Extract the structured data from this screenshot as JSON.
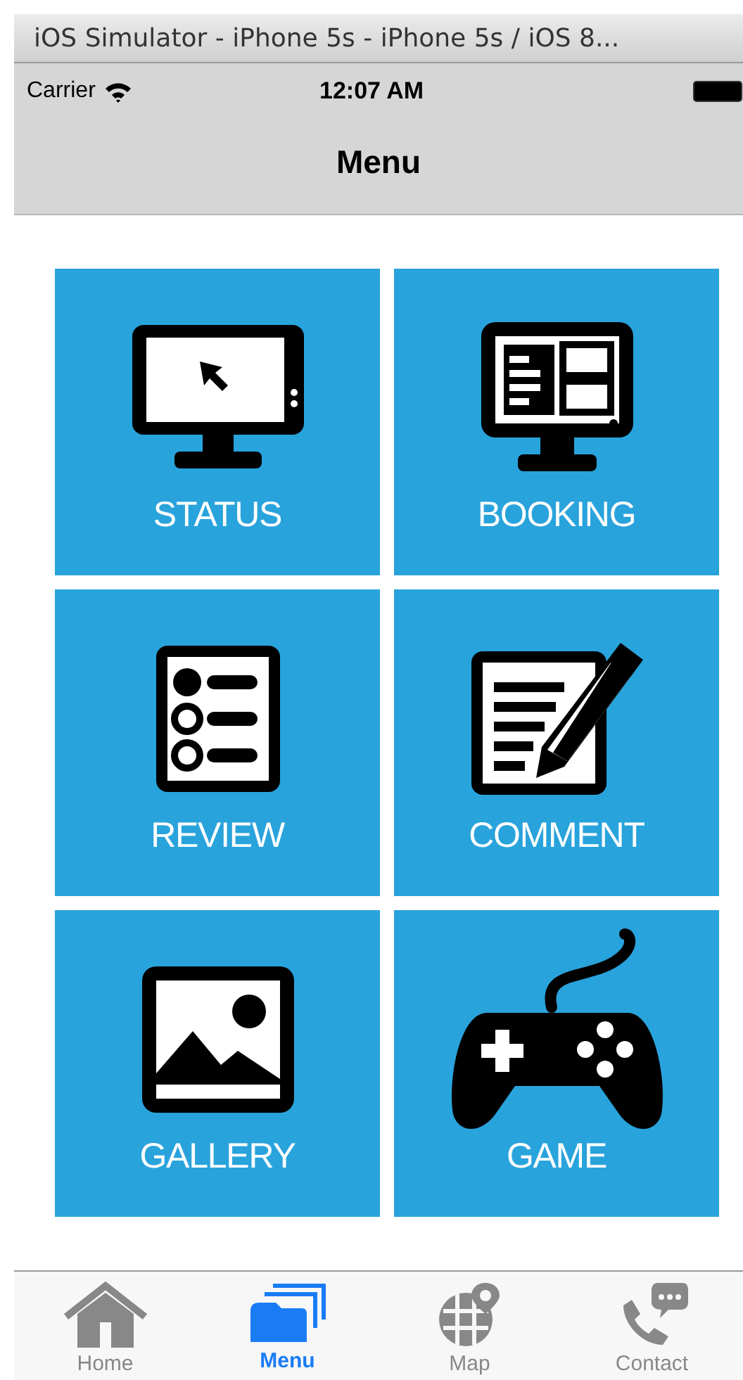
{
  "window": {
    "title": "iOS Simulator - iPhone 5s - iPhone 5s / iOS 8..."
  },
  "status_bar": {
    "carrier": "Carrier",
    "time": "12:07 AM"
  },
  "nav_bar": {
    "title": "Menu"
  },
  "tiles": [
    {
      "label": "STATUS",
      "kind": "monitor"
    },
    {
      "label": "BOOKING",
      "kind": "layout"
    },
    {
      "label": "REVIEW",
      "kind": "checklist"
    },
    {
      "label": "COMMENT",
      "kind": "note"
    },
    {
      "label": "GALLERY",
      "kind": "image"
    },
    {
      "label": "GAME",
      "kind": "gamepad"
    }
  ],
  "tab_bar": [
    {
      "label": "Home",
      "kind": "home",
      "selected": false
    },
    {
      "label": "Menu",
      "kind": "folders",
      "selected": true
    },
    {
      "label": "Map",
      "kind": "globe",
      "selected": false
    },
    {
      "label": "Contact",
      "kind": "phone",
      "selected": false
    }
  ]
}
